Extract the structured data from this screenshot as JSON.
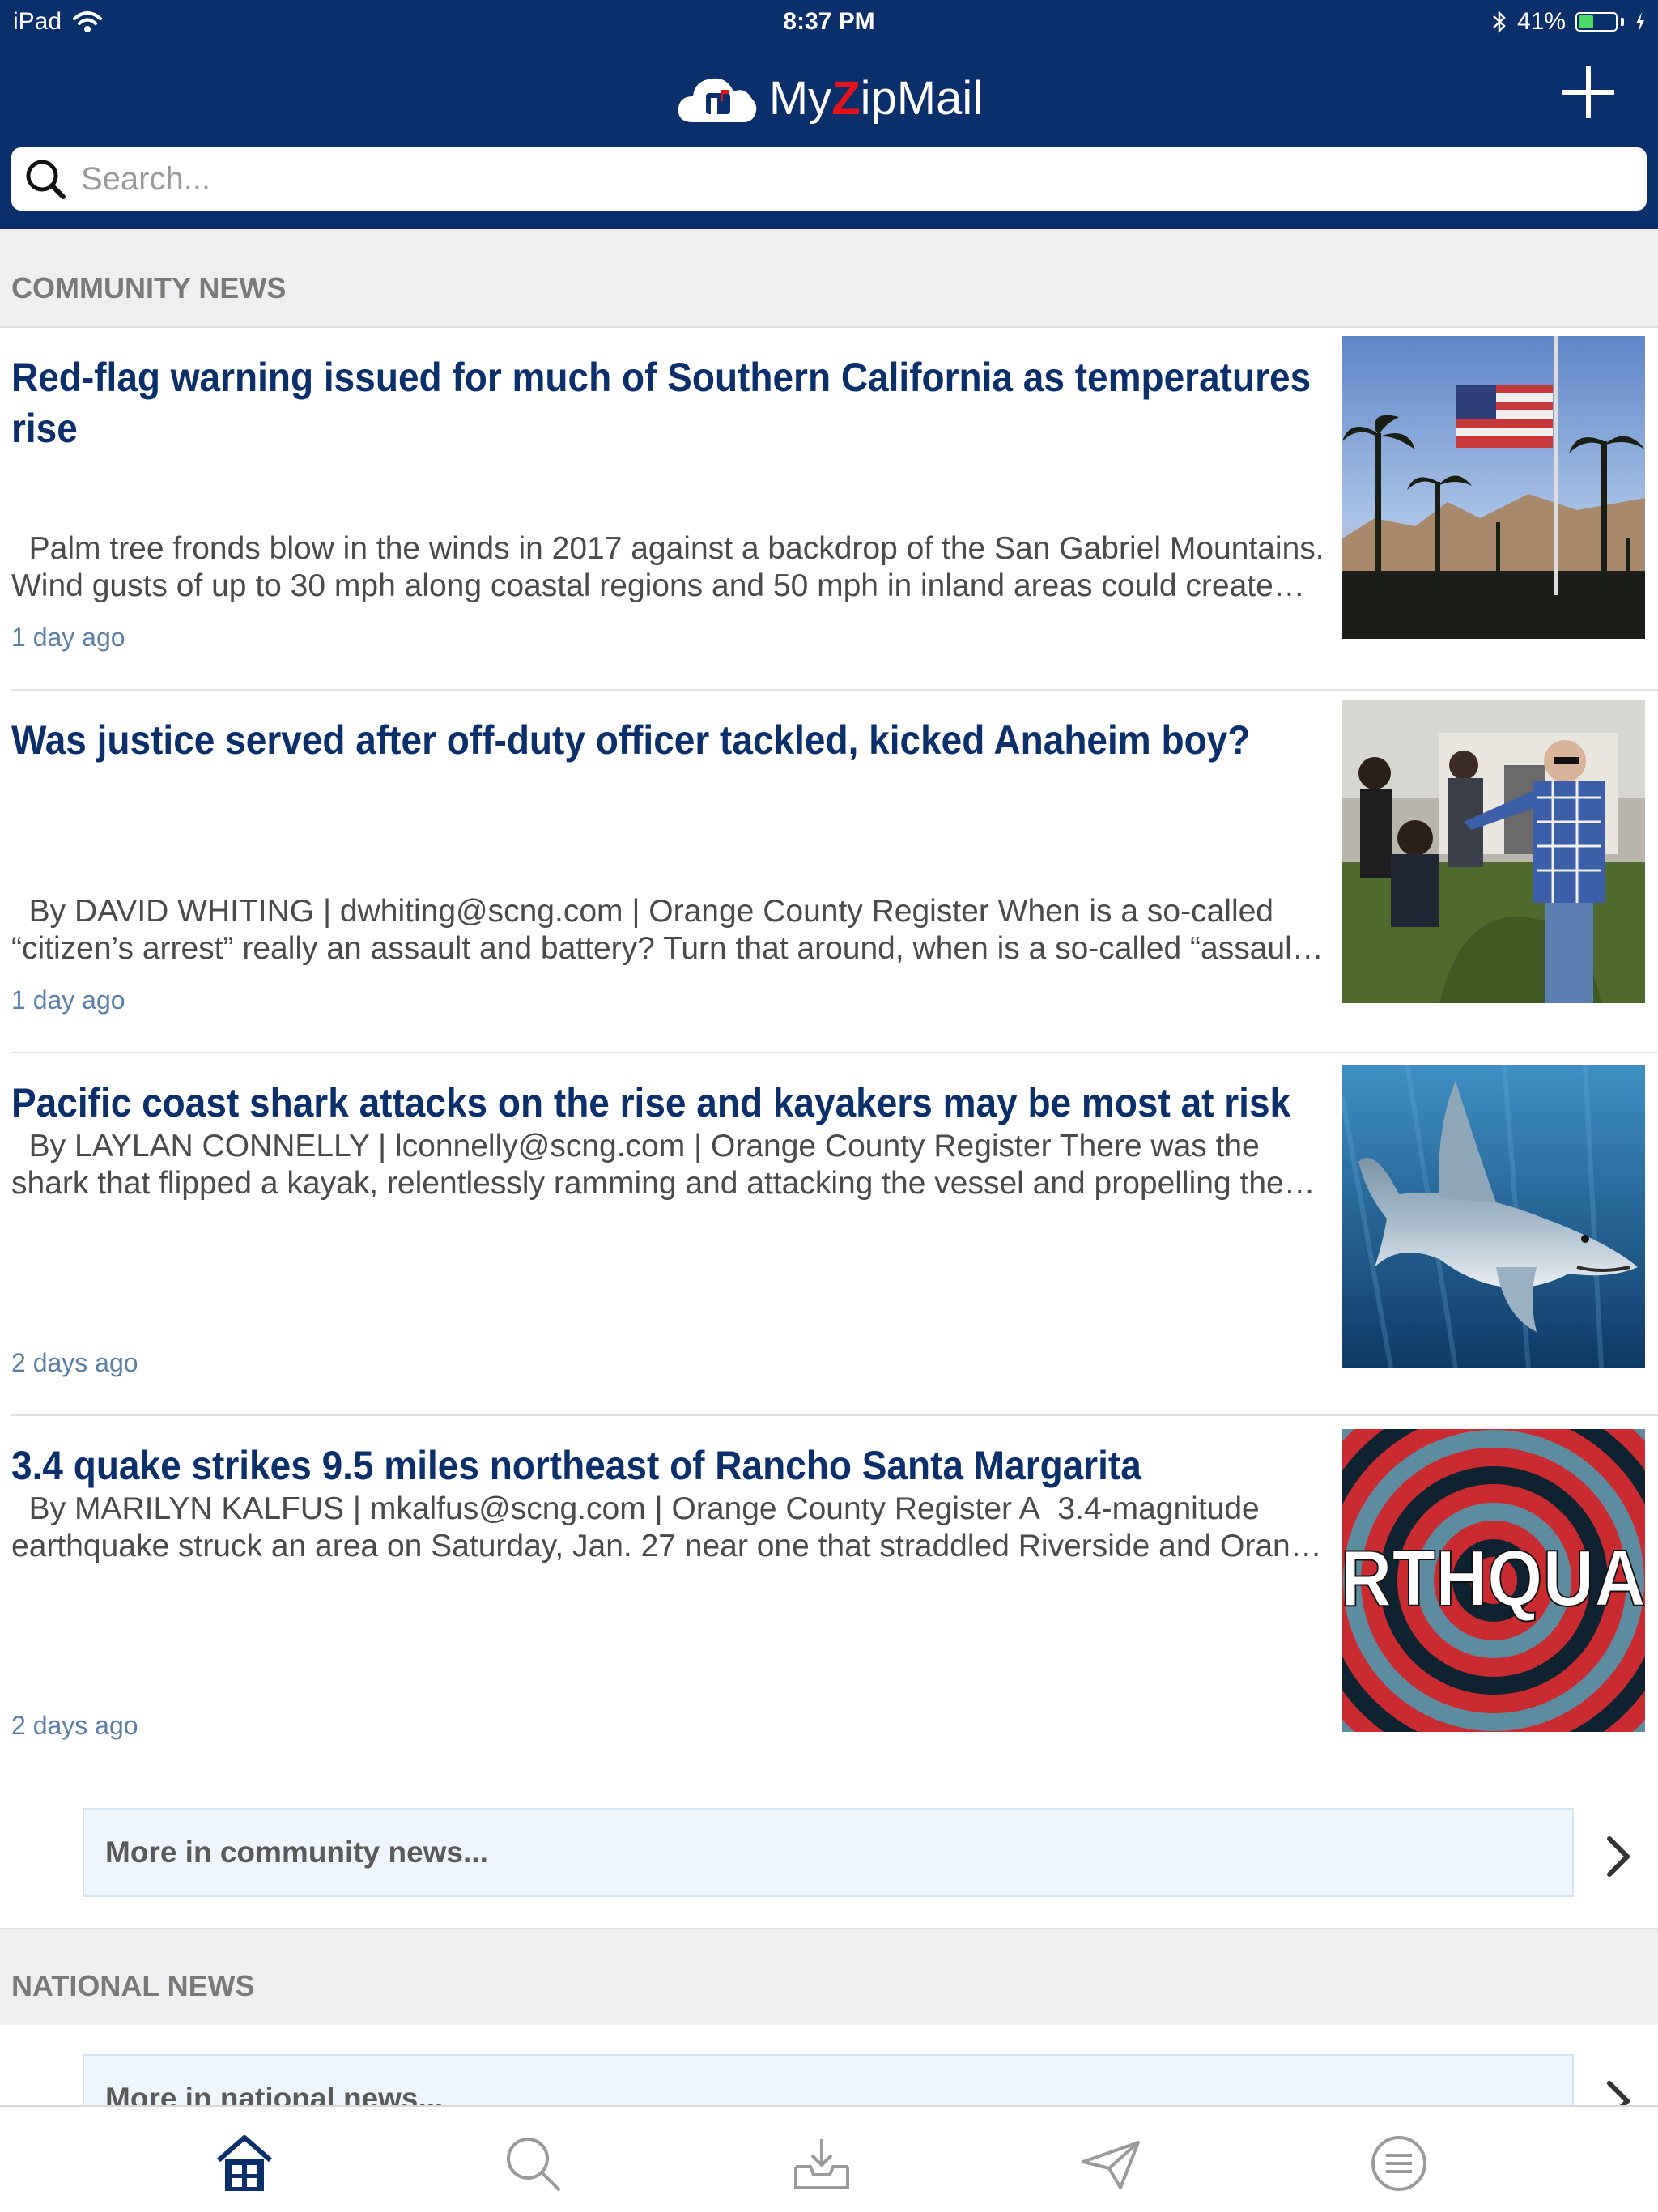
{
  "status_bar": {
    "device": "iPad",
    "time": "8:37 PM",
    "battery_percent": "41%",
    "battery_level": 0.41,
    "icons": [
      "wifi-icon",
      "bluetooth-icon",
      "battery-icon",
      "charging-icon"
    ]
  },
  "app": {
    "title_pre": "My",
    "title_accent": "Z",
    "title_post": "ipMail",
    "add_icon": "plus-icon",
    "accent_color": "#e3131b",
    "header_color": "#0a2f6a"
  },
  "search": {
    "placeholder": "Search...",
    "icon": "search-icon"
  },
  "community_section": {
    "title": "COMMUNITY NEWS",
    "articles": [
      {
        "title": "Red-flag warning issued for much of Southern California as temperatures rise",
        "summary": "  Palm tree fronds blow in the winds in 2017 against a backdrop of the San Gabriel Mountains. Wind gusts of up to 30 mph along coastal regions and 50 mph in inland areas could create dangerous fire conditions.",
        "time": "1 day ago",
        "image": "flag-palm-trees-photo"
      },
      {
        "title": "Was justice served after off-duty officer tackled, kicked Anaheim boy?",
        "summary": "  By DAVID WHITING | dwhiting@scng.com | Orange County Register When is a so-called “citizen’s arrest” really an assault and battery? Turn that around, when is a so-called “assault and battery” really a citizen’s arrest?",
        "time": "1 day ago",
        "image": "officer-confrontation-photo"
      },
      {
        "title": "Pacific coast shark attacks on the rise and kayakers may be most at risk",
        "summary": "  By LAYLAN CONNELLY | lconnelly@scng.com | Orange County Register There was the shark that flipped a kayak, relentlessly ramming and attacking the vessel and propelling the paddler into the water.",
        "time": "2 days ago",
        "image": "shark-photo"
      },
      {
        "title": "3.4 quake strikes 9.5 miles northeast of Rancho Santa Margarita",
        "summary": "  By MARILYN KALFUS | mkalfus@scng.com | Orange County Register A  3.4-magnitude earthquake struck an area on Saturday, Jan. 27 near one that straddled Riverside and Orange counties.",
        "time": "2 days ago",
        "image": "earthquake-graphic",
        "image_text": "RTHQUA"
      }
    ],
    "more_label": "More in community news..."
  },
  "national_section": {
    "title": "NATIONAL NEWS",
    "more_label": "More in national news..."
  },
  "tab_bar": {
    "tabs": [
      "home-icon",
      "search-icon",
      "inbox-icon",
      "send-icon",
      "menu-icon"
    ],
    "active_color": "#0a2f6a",
    "inactive_color": "#9a9a9a"
  }
}
